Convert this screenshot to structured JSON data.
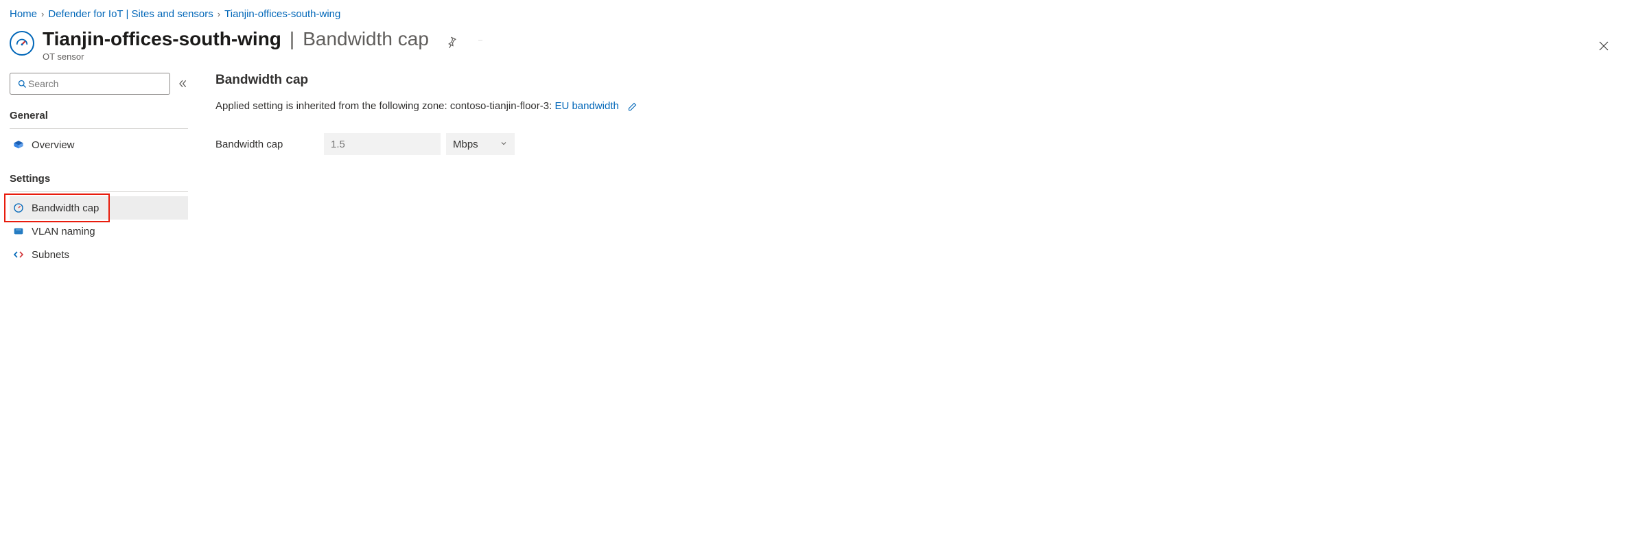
{
  "breadcrumb": {
    "items": [
      {
        "label": "Home"
      },
      {
        "label": "Defender for IoT | Sites and sensors"
      },
      {
        "label": "Tianjin-offices-south-wing"
      }
    ]
  },
  "header": {
    "title": "Tianjin-offices-south-wing",
    "subtitle": "Bandwidth cap",
    "caption": "OT sensor"
  },
  "sidebar": {
    "search_placeholder": "Search",
    "groups": {
      "general": {
        "title": "General"
      },
      "settings": {
        "title": "Settings"
      }
    },
    "items": {
      "overview": "Overview",
      "bandwidth_cap": "Bandwidth cap",
      "vlan_naming": "VLAN naming",
      "subnets": "Subnets"
    }
  },
  "main": {
    "section_title": "Bandwidth cap",
    "description_prefix": "Applied setting is inherited from the following zone: contoso-tianjin-floor-3: ",
    "policy_link": "EU bandwidth",
    "form": {
      "label": "Bandwidth cap",
      "value": "1.5",
      "unit": "Mbps"
    }
  }
}
